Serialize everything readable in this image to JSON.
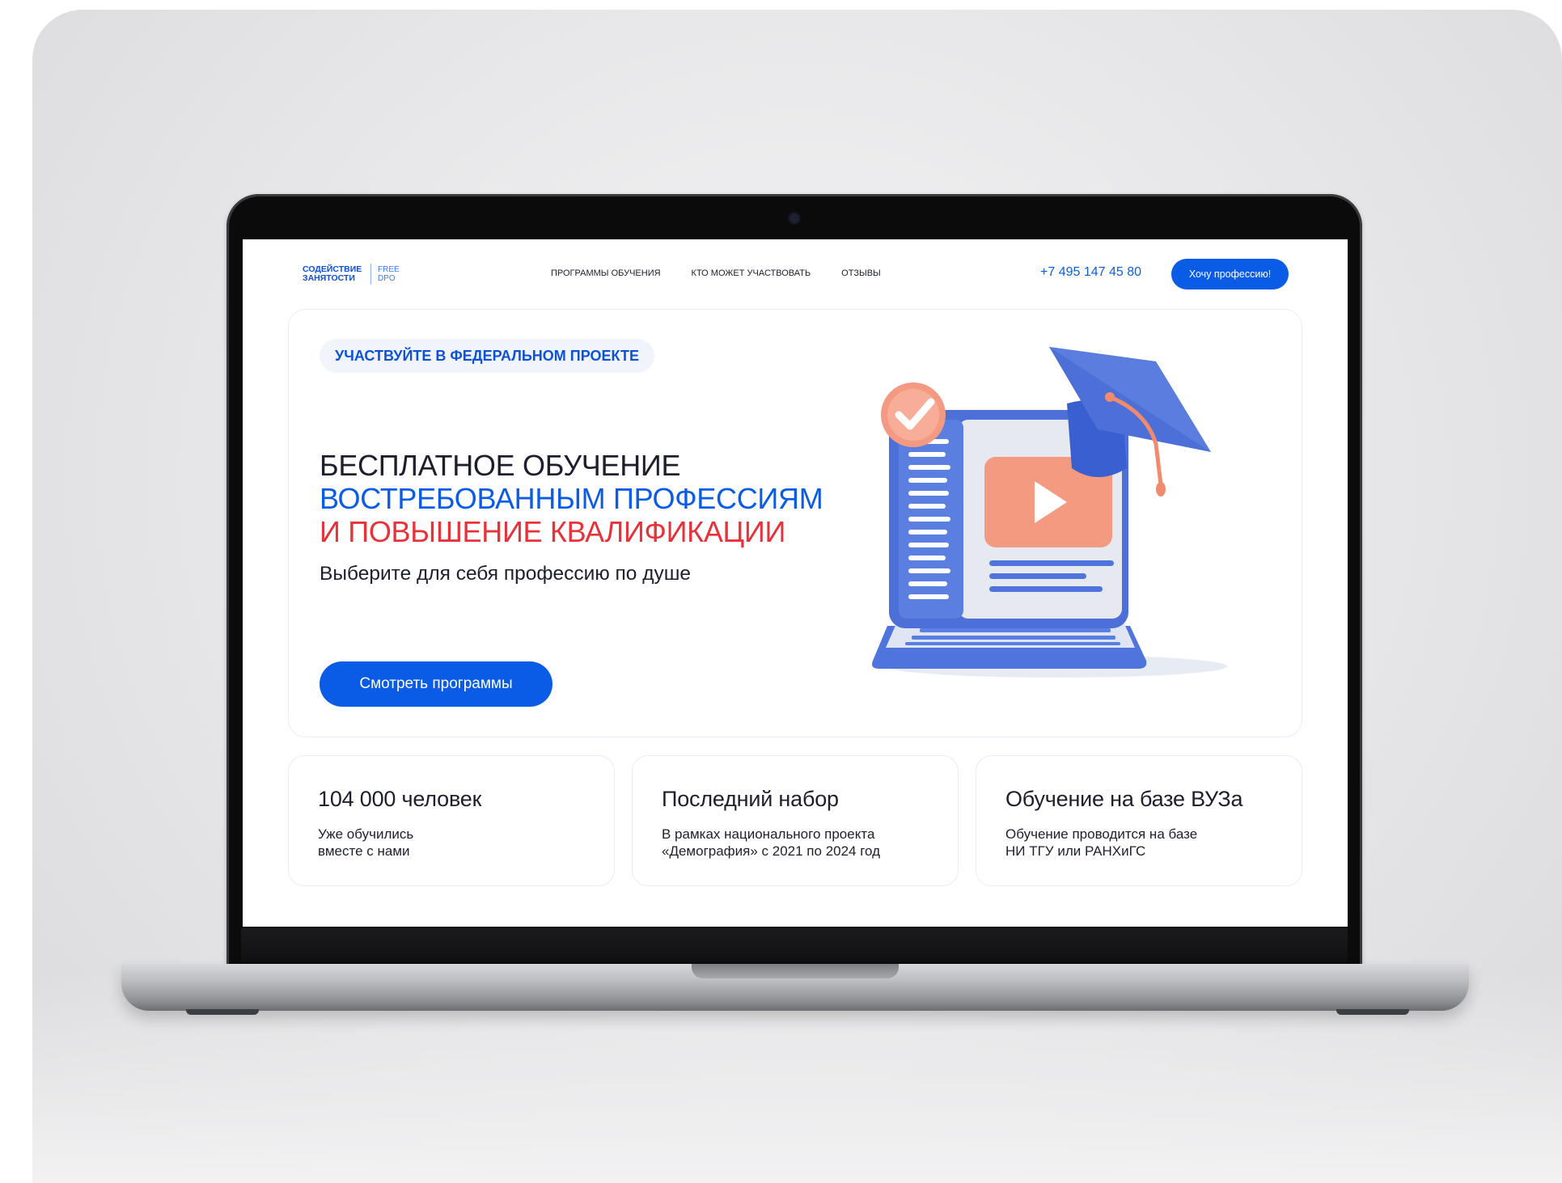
{
  "header": {
    "logo_main": "СОДЕЙСТВИЕ ЗАНЯТОСТИ",
    "logo_sub": "FREE DPO",
    "nav": [
      "ПРОГРАММЫ ОБУЧЕНИЯ",
      "КТО МОЖЕТ УЧАСТВОВАТЬ",
      "ОТЗЫВЫ"
    ],
    "phone": "+7 495 147 45 80",
    "cta": "Хочу профессию!"
  },
  "hero": {
    "badge": "УЧАСТВУЙТЕ В ФЕДЕРАЛЬНОМ ПРОЕКТЕ",
    "title_line1": "БЕСПЛАТНОЕ ОБУЧЕНИЕ",
    "title_line2": "ВОСТРЕБОВАННЫМ ПРОФЕССИЯМ",
    "title_line3": "И ПОВЫШЕНИЕ КВАЛИФИКАЦИИ",
    "subtitle": "Выберите для себя профессию по душе",
    "cta": "Смотреть программы"
  },
  "stats": [
    {
      "title": "104 000 человек",
      "desc": "Уже обучились\nвместе с нами"
    },
    {
      "title": "Последний набор",
      "desc": "В рамках национального проекта\n«Демография» с 2021 по 2024 год"
    },
    {
      "title": "Обучение на базе ВУЗа",
      "desc": "Обучение проводится на базе\nНИ ТГУ или РАНХиГС"
    }
  ],
  "colors": {
    "brand_blue": "#0a5ce6",
    "accent_red": "#e8323a",
    "text_dark": "#1d1f2c",
    "illustration_blue": "#5b7fe0",
    "illustration_orange": "#f59a82"
  },
  "icons": [
    "laptop-illustration",
    "graduation-cap-icon",
    "play-icon",
    "checkmark-badge-icon"
  ]
}
